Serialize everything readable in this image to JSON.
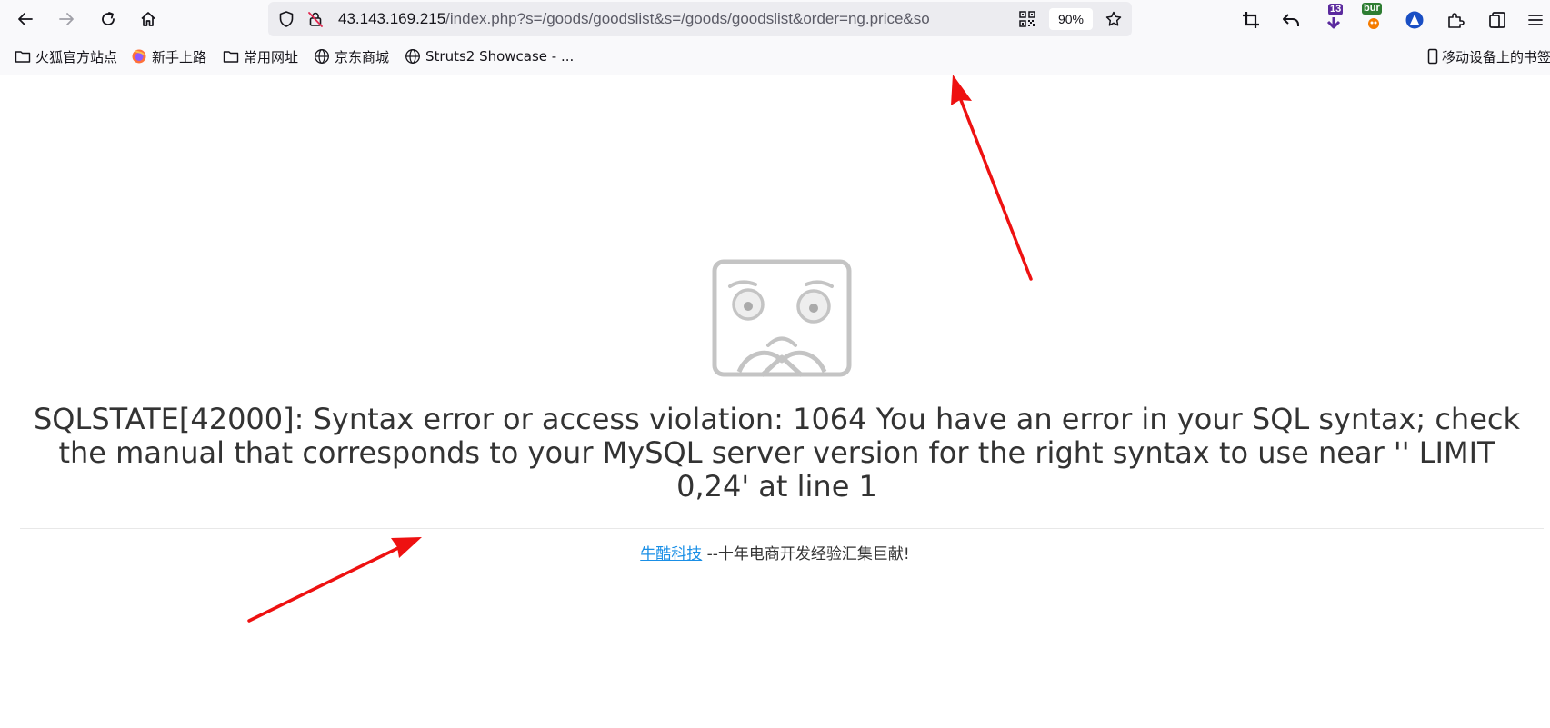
{
  "browser": {
    "url_host": "43.143.169.215",
    "url_path": "/index.php?s=/goods/goodslist&s=/goods/goodslist&order=ng.price&so",
    "zoom": "90%",
    "extensions": [
      {
        "name": "crop-icon"
      },
      {
        "name": "undo-icon"
      },
      {
        "name": "download-extension-icon",
        "badge": "13",
        "badge_color": "#5b2a9e"
      },
      {
        "name": "burp-extension-icon",
        "badge": "bur",
        "badge_color": "#2e7d32"
      },
      {
        "name": "proxy-extension-icon"
      },
      {
        "name": "extensions-puzzle-icon"
      },
      {
        "name": "tab-manager-icon"
      },
      {
        "name": "menu-icon"
      }
    ]
  },
  "bookmarks": {
    "items": [
      "火狐官方站点",
      "新手上路",
      "常用网址",
      "京东商城",
      "Struts2 Showcase - ..."
    ],
    "mobile": "移动设备上的书签"
  },
  "page": {
    "error_message": "SQLSTATE[42000]: Syntax error or access violation: 1064 You have an error in your SQL syntax; check the manual that corresponds to your MySQL server version for the right syntax to use near '' LIMIT 0,24' at line 1",
    "footer_link": "牛酷科技",
    "footer_text": " --十年电商开发经验汇集巨献!"
  },
  "colors": {
    "annotation_arrow": "#ee1111",
    "link": "#1a8fe6",
    "icon_gray": "#bbbbbb"
  }
}
